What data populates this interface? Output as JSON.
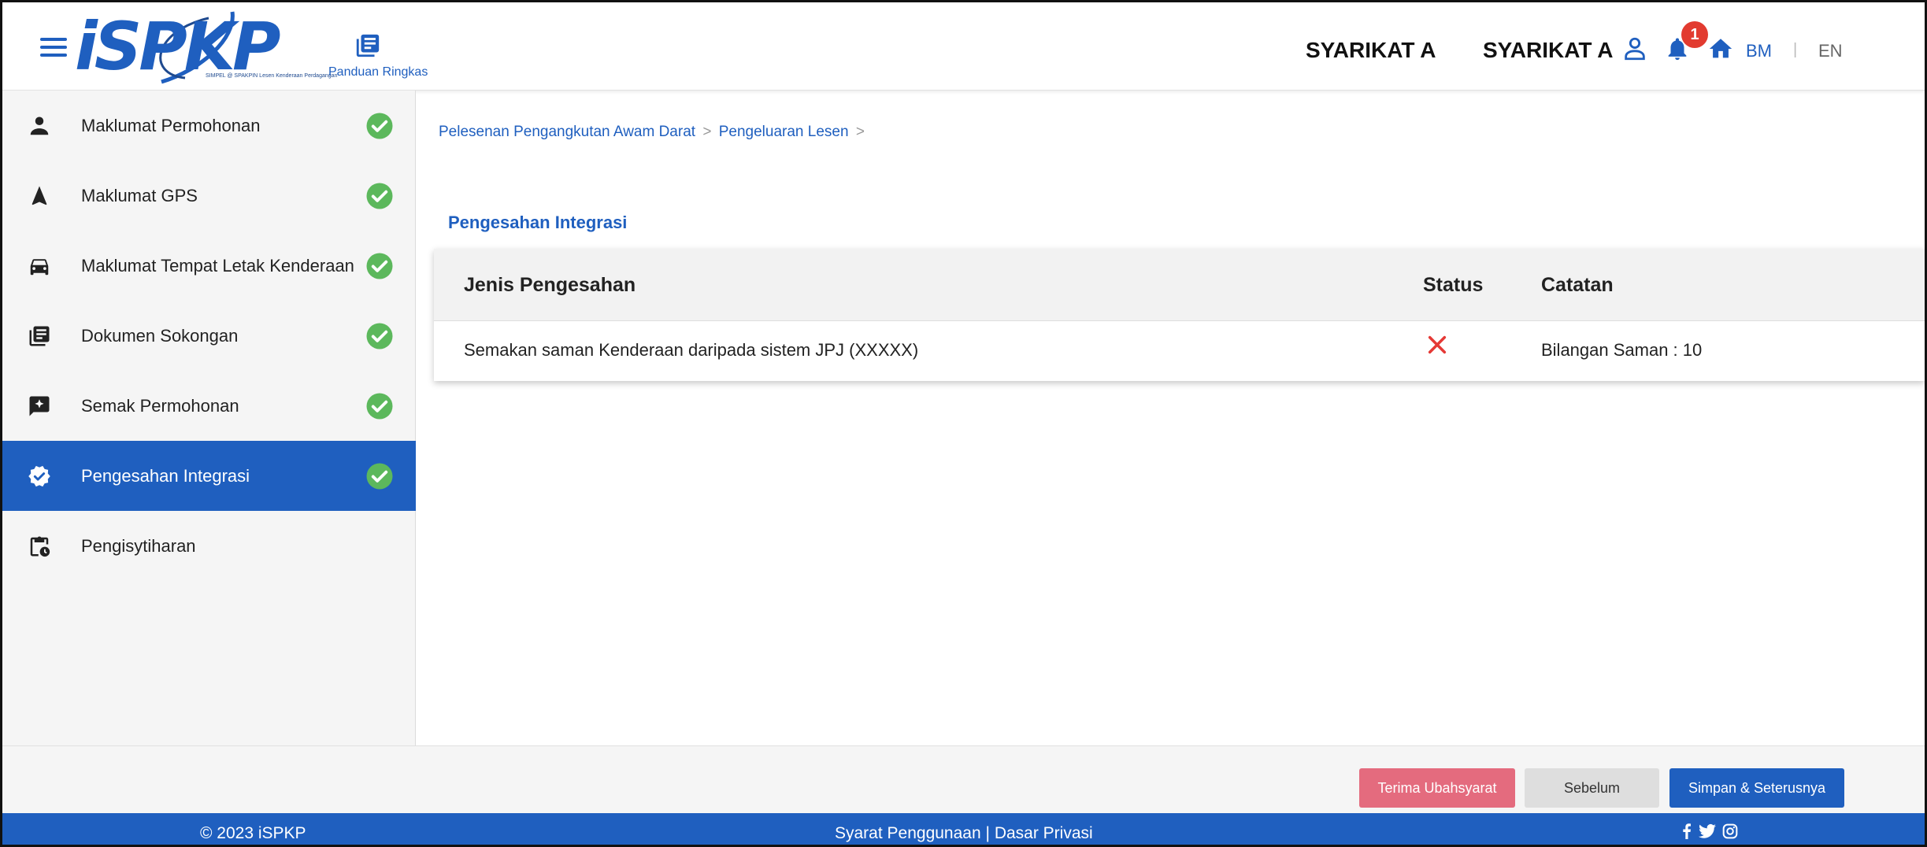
{
  "header": {
    "logo_text": "iSPKP",
    "logo_tagline": "SIMPEL @ SPAKPIN Lesen Kenderaan Perdagangan",
    "guide_label": "Panduan Ringkas",
    "company_name": "SYARIKAT A",
    "user_name": "SYARIKAT A",
    "notification_count": "1",
    "lang_bm": "BM",
    "lang_sep": "|",
    "lang_en": "EN"
  },
  "sidebar": {
    "items": [
      {
        "label": "Maklumat Permohonan",
        "icon": "person-icon",
        "completed": true
      },
      {
        "label": "Maklumat GPS",
        "icon": "navigation-icon",
        "completed": true
      },
      {
        "label": "Maklumat Tempat Letak Kenderaan",
        "icon": "car-icon",
        "completed": true
      },
      {
        "label": "Dokumen Sokongan",
        "icon": "document-icon",
        "completed": true
      },
      {
        "label": "Semak Permohonan",
        "icon": "review-icon",
        "completed": true
      },
      {
        "label": "Pengesahan Integrasi",
        "icon": "verified-icon",
        "completed": true,
        "active": true
      },
      {
        "label": "Pengisytiharan",
        "icon": "clipboard-clock-icon",
        "completed": false
      }
    ]
  },
  "breadcrumb": {
    "item1": "Pelesenan Pengangkutan Awam Darat",
    "item2": "Pengeluaran Lesen",
    "separator": ">"
  },
  "main": {
    "section_title": "Pengesahan Integrasi",
    "table": {
      "headers": [
        "Jenis Pengesahan",
        "Status",
        "Catatan"
      ],
      "rows": [
        {
          "jenis": "Semakan saman Kenderaan daripada sistem JPJ (XXXXX)",
          "status": "failed",
          "catatan": "Bilangan Saman : 10"
        }
      ]
    }
  },
  "actions": {
    "accept_label": "Terima Ubahsyarat",
    "prev_label": "Sebelum",
    "next_label": "Simpan & Seterusnya"
  },
  "footer": {
    "copyright": "© 2023 iSPKP",
    "terms": "Syarat Penggunaan",
    "divider": "|",
    "privacy": "Dasar Privasi"
  },
  "colors": {
    "primary": "#1f5fbf",
    "success": "#5cb85c",
    "error": "#e53935",
    "accept_button": "#e46b7e"
  }
}
